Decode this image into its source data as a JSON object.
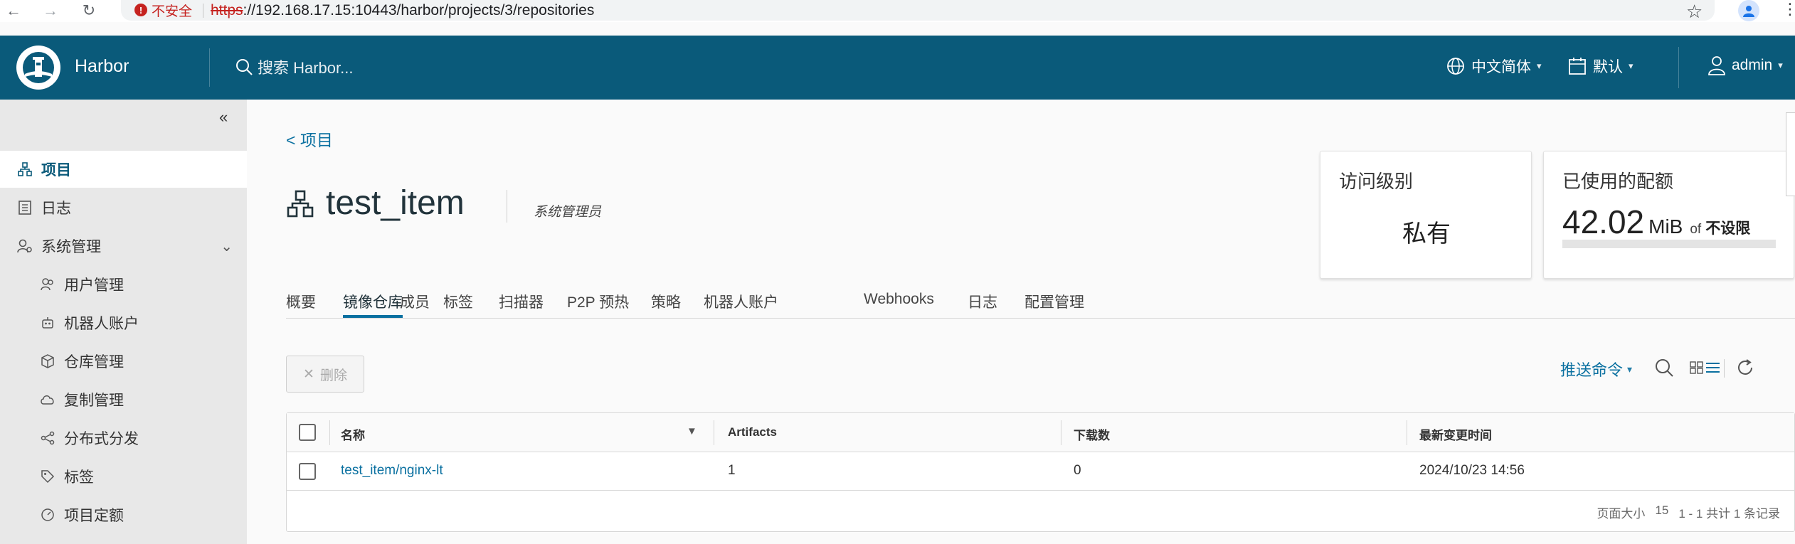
{
  "browser": {
    "security_label": "不安全",
    "url_scheme": "https",
    "url_rest": "://192.168.17.15:10443/harbor/projects/3/repositories"
  },
  "header": {
    "app_title": "Harbor",
    "search_placeholder": "搜索 Harbor...",
    "language": "中文简体",
    "theme": "默认",
    "user": "admin"
  },
  "sidebar": {
    "items": [
      {
        "label": "项目",
        "icon": "project-icon",
        "active": true
      },
      {
        "label": "日志",
        "icon": "log-icon"
      },
      {
        "label": "系统管理",
        "icon": "admin-icon",
        "expandable": true
      },
      {
        "label": "用户管理",
        "icon": "users-icon"
      },
      {
        "label": "机器人账户",
        "icon": "robot-icon"
      },
      {
        "label": "仓库管理",
        "icon": "registry-icon"
      },
      {
        "label": "复制管理",
        "icon": "replication-icon"
      },
      {
        "label": "分布式分发",
        "icon": "share-icon"
      },
      {
        "label": "标签",
        "icon": "tag-icon"
      },
      {
        "label": "项目定额",
        "icon": "quota-icon"
      }
    ]
  },
  "project": {
    "back_label": "<  项目",
    "name": "test_item",
    "role": "系统管理员"
  },
  "cards": {
    "access": {
      "title": "访问级别",
      "value": "私有"
    },
    "quota": {
      "title": "已使用的配额",
      "number": "42.02",
      "unit": "MiB",
      "of": "of",
      "limit": "不设限",
      "used_fraction": 0
    }
  },
  "tabs": [
    "概要",
    "镜像仓库",
    "成员",
    "标签",
    "扫描器",
    "P2P 预热",
    "策略",
    "机器人账户",
    "Webhooks",
    "日志",
    "配置管理"
  ],
  "active_tab": "镜像仓库",
  "toolbar": {
    "delete_label": "删除",
    "push_command": "推送命令"
  },
  "grid": {
    "columns": [
      "名称",
      "Artifacts",
      "下载数",
      "最新变更时间"
    ],
    "rows": [
      {
        "name": "test_item/nginx-lt",
        "artifacts": "1",
        "pulls": "0",
        "updated": "2024/10/23 14:56"
      }
    ],
    "footer": {
      "page_size_label": "页面大小",
      "page_size": "15",
      "summary": "1 - 1 共计 1 条记录"
    }
  }
}
